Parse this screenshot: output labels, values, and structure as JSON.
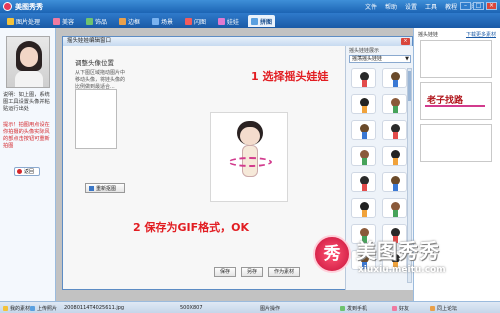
{
  "app": {
    "title": "美图秀秀",
    "menu": [
      "文件",
      "帮助",
      "设置",
      "工具",
      "教程",
      "皮肤"
    ]
  },
  "tabs": [
    {
      "label": "图片处理",
      "icon": "photo-edit-icon",
      "color": "#f4c23a"
    },
    {
      "label": "美容",
      "icon": "beauty-icon",
      "color": "#f07aa0"
    },
    {
      "label": "饰品",
      "icon": "accessory-icon",
      "color": "#6fc36f"
    },
    {
      "label": "边框",
      "icon": "frame-icon",
      "color": "#e9a04a"
    },
    {
      "label": "场景",
      "icon": "scene-icon",
      "color": "#7ab3f0"
    },
    {
      "label": "闪图",
      "icon": "flash-icon",
      "color": "#f25c5c"
    },
    {
      "label": "娃娃",
      "icon": "doll-icon",
      "color": "#e07ad0"
    },
    {
      "label": "拼图",
      "icon": "collage-icon",
      "color": "#5aa0e0"
    }
  ],
  "active_tab": "拼图",
  "sidebar": {
    "desc": "说明：如上图，系统图工具设置头像并粘贴运行出处",
    "tip": "提示！拍图用点设在你拍摄的头像实际风的部点击按钮可重新拍图",
    "back_label": "返回"
  },
  "dialog": {
    "title": "摇头娃娃编辑窗口",
    "close_label": "×",
    "adjust_title": "调整头像位置",
    "adjust_desc": "从下图区域拖动图片中移动头像，将娃头像的比例做到最适合...",
    "reselect_label": "重新抠图",
    "actions": [
      "保存",
      "另存",
      "作为素材"
    ],
    "right_panel": {
      "title": "摇头娃娃展示",
      "select_value": "摇荡摇头娃娃"
    }
  },
  "annotations": {
    "step1": "1 选择摇头娃娃",
    "step2": "2 保存为GIF格式，OK"
  },
  "right_column": {
    "title": "摇头娃娃",
    "link": "下载更多素材",
    "frame_text": "老子找路"
  },
  "statusbar": {
    "filename": "20080114T4025611.jpg",
    "size": "500X807",
    "status": "图片操作",
    "items": [
      "我的素材",
      "上传照片",
      "发到手机",
      "好友",
      "同上论坛"
    ]
  },
  "watermark": {
    "logo_char": "秀",
    "name": "美图秀秀",
    "url": "xiuxiu.meitu.com"
  }
}
